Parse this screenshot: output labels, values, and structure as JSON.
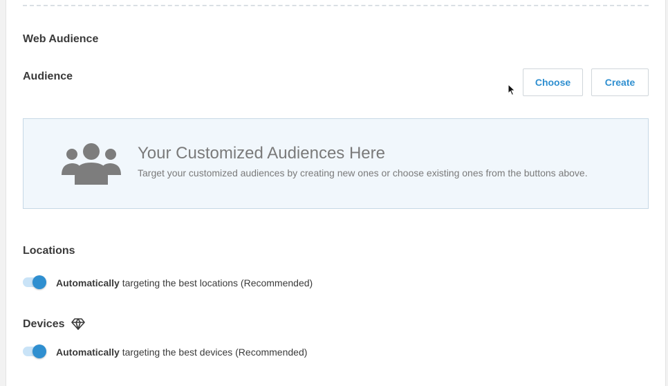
{
  "web_audience": {
    "title": "Web Audience",
    "audience_label": "Audience",
    "choose_label": "Choose",
    "create_label": "Create",
    "empty_state": {
      "icon": "users-icon",
      "heading": "Your Customized Audiences Here",
      "description": "Target your customized audiences by creating new ones or choose existing ones from the buttons above."
    }
  },
  "locations": {
    "title": "Locations",
    "toggle_on": true,
    "toggle_bold": "Automatically",
    "toggle_text": " targeting the best locations (Recommended)"
  },
  "devices": {
    "title": "Devices",
    "premium_icon": "diamond-icon",
    "toggle_on": true,
    "toggle_bold": "Automatically",
    "toggle_text": " targeting the best devices (Recommended)"
  },
  "colors": {
    "accent": "#2f8fd0",
    "empty_bg": "#f1f7fc"
  }
}
